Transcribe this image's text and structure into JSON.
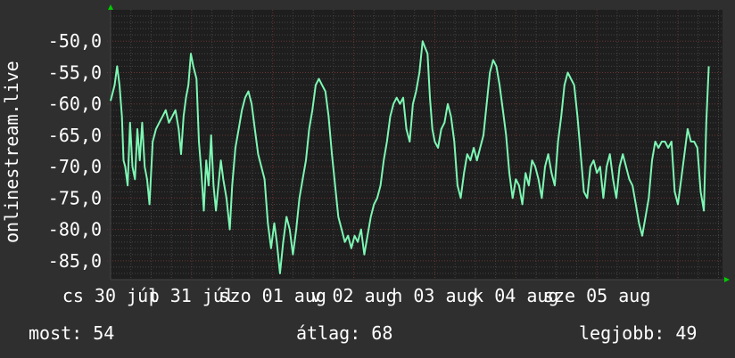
{
  "chart_data": {
    "type": "line",
    "title": "",
    "ylabel": "onlinestream.live",
    "xlabel": "",
    "ylim": [
      -88,
      -45
    ],
    "yticks": [
      -50,
      -55,
      -60,
      -65,
      -70,
      -75,
      -80,
      -85
    ],
    "ytick_labels": [
      "-50,0",
      "-55,0",
      "-60,0",
      "-65,0",
      "-70,0",
      "-75,0",
      "-80,0",
      "-85,0"
    ],
    "xlim": [
      0,
      7.55
    ],
    "xticks": [
      {
        "x": 0.0,
        "label": "cs 30 júl"
      },
      {
        "x": 1.0,
        "label": "p 31 júl"
      },
      {
        "x": 2.0,
        "label": "szo 01 aug"
      },
      {
        "x": 3.0,
        "label": "v 02 aug"
      },
      {
        "x": 4.0,
        "label": "h 03 aug"
      },
      {
        "x": 5.0,
        "label": "k 04 aug"
      },
      {
        "x": 6.0,
        "label": "sze 05 aug"
      }
    ],
    "grid": true,
    "series": [
      {
        "color": "#7df7b4",
        "points": [
          [
            0.0,
            -59.5
          ],
          [
            0.05,
            -57
          ],
          [
            0.08,
            -54
          ],
          [
            0.11,
            -57
          ],
          [
            0.14,
            -62
          ],
          [
            0.16,
            -69
          ],
          [
            0.18,
            -70
          ],
          [
            0.21,
            -73
          ],
          [
            0.24,
            -63
          ],
          [
            0.27,
            -70
          ],
          [
            0.3,
            -72
          ],
          [
            0.33,
            -64
          ],
          [
            0.36,
            -69
          ],
          [
            0.39,
            -63
          ],
          [
            0.42,
            -70
          ],
          [
            0.45,
            -72
          ],
          [
            0.48,
            -76
          ],
          [
            0.52,
            -66
          ],
          [
            0.56,
            -64
          ],
          [
            0.6,
            -63
          ],
          [
            0.64,
            -62
          ],
          [
            0.68,
            -61
          ],
          [
            0.72,
            -63
          ],
          [
            0.76,
            -62
          ],
          [
            0.8,
            -61
          ],
          [
            0.84,
            -64
          ],
          [
            0.87,
            -68
          ],
          [
            0.9,
            -62
          ],
          [
            0.93,
            -59
          ],
          [
            0.96,
            -57
          ],
          [
            0.99,
            -52
          ],
          [
            1.02,
            -54
          ],
          [
            1.06,
            -56
          ],
          [
            1.09,
            -66
          ],
          [
            1.12,
            -71
          ],
          [
            1.15,
            -77
          ],
          [
            1.18,
            -69
          ],
          [
            1.21,
            -73
          ],
          [
            1.24,
            -65
          ],
          [
            1.27,
            -73
          ],
          [
            1.3,
            -77
          ],
          [
            1.33,
            -73
          ],
          [
            1.36,
            -69
          ],
          [
            1.39,
            -72
          ],
          [
            1.43,
            -75
          ],
          [
            1.47,
            -80
          ],
          [
            1.5,
            -73
          ],
          [
            1.54,
            -67
          ],
          [
            1.58,
            -64
          ],
          [
            1.62,
            -61
          ],
          [
            1.66,
            -59
          ],
          [
            1.7,
            -58
          ],
          [
            1.74,
            -60
          ],
          [
            1.78,
            -64
          ],
          [
            1.82,
            -68
          ],
          [
            1.86,
            -70
          ],
          [
            1.9,
            -72
          ],
          [
            1.94,
            -79
          ],
          [
            1.98,
            -83
          ],
          [
            2.02,
            -79
          ],
          [
            2.05,
            -82
          ],
          [
            2.09,
            -87
          ],
          [
            2.13,
            -82
          ],
          [
            2.17,
            -78
          ],
          [
            2.21,
            -80
          ],
          [
            2.25,
            -84
          ],
          [
            2.29,
            -80
          ],
          [
            2.33,
            -75
          ],
          [
            2.37,
            -72
          ],
          [
            2.41,
            -69
          ],
          [
            2.45,
            -64
          ],
          [
            2.49,
            -61
          ],
          [
            2.53,
            -57
          ],
          [
            2.57,
            -56
          ],
          [
            2.61,
            -57
          ],
          [
            2.65,
            -58
          ],
          [
            2.69,
            -62
          ],
          [
            2.73,
            -68
          ],
          [
            2.77,
            -73
          ],
          [
            2.81,
            -78
          ],
          [
            2.85,
            -80
          ],
          [
            2.89,
            -82
          ],
          [
            2.93,
            -81
          ],
          [
            2.97,
            -83
          ],
          [
            3.01,
            -81
          ],
          [
            3.05,
            -82
          ],
          [
            3.09,
            -80
          ],
          [
            3.13,
            -84
          ],
          [
            3.17,
            -81
          ],
          [
            3.21,
            -78
          ],
          [
            3.25,
            -76
          ],
          [
            3.29,
            -75
          ],
          [
            3.33,
            -73
          ],
          [
            3.37,
            -69
          ],
          [
            3.41,
            -66
          ],
          [
            3.45,
            -62
          ],
          [
            3.49,
            -60
          ],
          [
            3.53,
            -59
          ],
          [
            3.57,
            -60
          ],
          [
            3.61,
            -59
          ],
          [
            3.65,
            -64
          ],
          [
            3.69,
            -66
          ],
          [
            3.73,
            -60
          ],
          [
            3.77,
            -58
          ],
          [
            3.81,
            -55
          ],
          [
            3.85,
            -50
          ],
          [
            3.88,
            -51
          ],
          [
            3.91,
            -52
          ],
          [
            3.94,
            -59
          ],
          [
            3.97,
            -64
          ],
          [
            4.0,
            -66
          ],
          [
            4.04,
            -67
          ],
          [
            4.08,
            -64
          ],
          [
            4.12,
            -63
          ],
          [
            4.16,
            -60
          ],
          [
            4.2,
            -62
          ],
          [
            4.24,
            -66
          ],
          [
            4.28,
            -73
          ],
          [
            4.32,
            -75
          ],
          [
            4.36,
            -71
          ],
          [
            4.4,
            -68
          ],
          [
            4.44,
            -69
          ],
          [
            4.48,
            -67
          ],
          [
            4.52,
            -69
          ],
          [
            4.56,
            -67
          ],
          [
            4.6,
            -65
          ],
          [
            4.64,
            -60
          ],
          [
            4.68,
            -55
          ],
          [
            4.72,
            -53
          ],
          [
            4.76,
            -54
          ],
          [
            4.8,
            -57
          ],
          [
            4.84,
            -61
          ],
          [
            4.88,
            -65
          ],
          [
            4.92,
            -71
          ],
          [
            4.96,
            -75
          ],
          [
            5.0,
            -72
          ],
          [
            5.04,
            -73
          ],
          [
            5.08,
            -76
          ],
          [
            5.12,
            -71
          ],
          [
            5.16,
            -73
          ],
          [
            5.2,
            -69
          ],
          [
            5.24,
            -70
          ],
          [
            5.28,
            -72
          ],
          [
            5.32,
            -75
          ],
          [
            5.36,
            -70
          ],
          [
            5.4,
            -68
          ],
          [
            5.44,
            -71
          ],
          [
            5.48,
            -73
          ],
          [
            5.52,
            -66
          ],
          [
            5.56,
            -62
          ],
          [
            5.6,
            -57
          ],
          [
            5.64,
            -55
          ],
          [
            5.68,
            -56
          ],
          [
            5.72,
            -57
          ],
          [
            5.76,
            -62
          ],
          [
            5.8,
            -68
          ],
          [
            5.84,
            -74
          ],
          [
            5.88,
            -75
          ],
          [
            5.92,
            -70
          ],
          [
            5.96,
            -69
          ],
          [
            6.0,
            -71
          ],
          [
            6.04,
            -70
          ],
          [
            6.08,
            -75
          ],
          [
            6.12,
            -70
          ],
          [
            6.16,
            -68
          ],
          [
            6.2,
            -72
          ],
          [
            6.24,
            -75
          ],
          [
            6.28,
            -70
          ],
          [
            6.32,
            -68
          ],
          [
            6.36,
            -70
          ],
          [
            6.4,
            -72
          ],
          [
            6.44,
            -73
          ],
          [
            6.48,
            -76
          ],
          [
            6.52,
            -79
          ],
          [
            6.56,
            -81
          ],
          [
            6.6,
            -78
          ],
          [
            6.64,
            -75
          ],
          [
            6.68,
            -69
          ],
          [
            6.72,
            -66
          ],
          [
            6.76,
            -67
          ],
          [
            6.8,
            -66
          ],
          [
            6.84,
            -66
          ],
          [
            6.88,
            -67
          ],
          [
            6.92,
            -66
          ],
          [
            6.96,
            -74
          ],
          [
            7.0,
            -76
          ],
          [
            7.04,
            -72
          ],
          [
            7.08,
            -68
          ],
          [
            7.12,
            -64
          ],
          [
            7.16,
            -66
          ],
          [
            7.2,
            -66
          ],
          [
            7.24,
            -67
          ],
          [
            7.28,
            -74
          ],
          [
            7.32,
            -77
          ],
          [
            7.35,
            -63
          ],
          [
            7.38,
            -54
          ]
        ]
      }
    ]
  },
  "stats": {
    "now": "most: 54",
    "avg": "átlag: 68",
    "best": "legjobb: 49"
  }
}
